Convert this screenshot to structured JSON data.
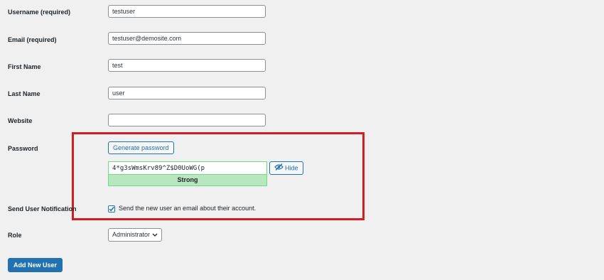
{
  "form": {
    "username": {
      "label": "Username (required)",
      "value": "testuser"
    },
    "email": {
      "label": "Email (required)",
      "value": "testuser@demosite.com"
    },
    "first_name": {
      "label": "First Name",
      "value": "test"
    },
    "last_name": {
      "label": "Last Name",
      "value": "user"
    },
    "website": {
      "label": "Website",
      "value": ""
    },
    "password": {
      "label": "Password",
      "generate_label": "Generate password",
      "value": "4*g3sWmsKrv89^Z$D0UoWG(p",
      "hide_label": "Hide",
      "hide_icon": "eye-slash-icon",
      "strength": "Strong"
    },
    "notification": {
      "label": "Send User Notification",
      "checked": true,
      "text": "Send the new user an email about their account."
    },
    "role": {
      "label": "Role",
      "selected": "Administrator"
    },
    "submit_label": "Add New User"
  },
  "colors": {
    "highlight": "#d11e26",
    "primary": "#2271b1",
    "strong_bg": "#b8e6bf",
    "strong_border": "#68de7c"
  }
}
